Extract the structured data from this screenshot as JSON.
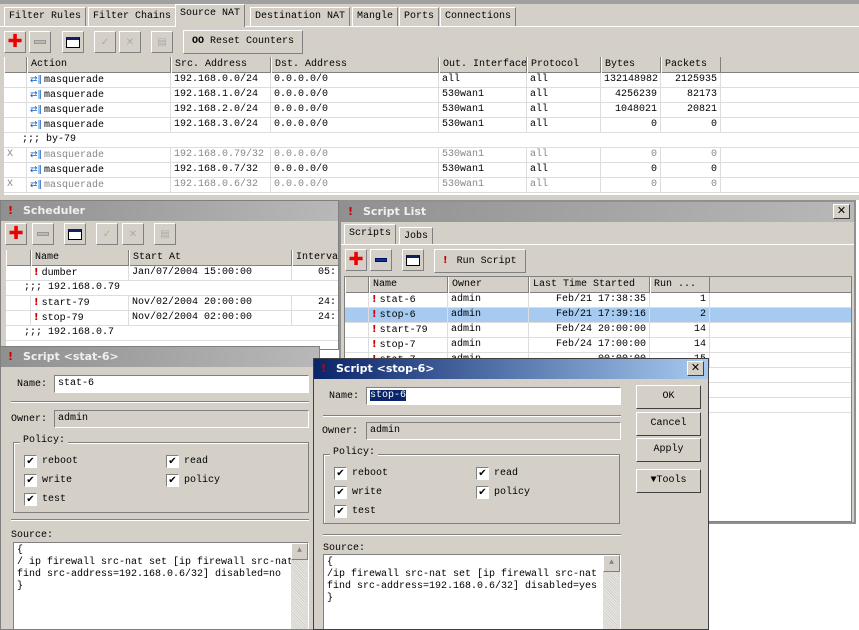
{
  "firewall": {
    "tabs": [
      "Filter Rules",
      "Filter Chains",
      "Source NAT",
      "Destination NAT",
      "Mangle",
      "Ports",
      "Connections"
    ],
    "selected_tab": "Source NAT",
    "reset_counters_label": "Reset Counters",
    "reset_counters_icon": "OO",
    "columns": [
      "",
      "Action",
      "Src. Address",
      "Dst. Address",
      "Out. Interface",
      "Protocol",
      "Bytes",
      "Packets"
    ],
    "rows": [
      {
        "flag": "",
        "action": "masquerade",
        "src": "192.168.0.0/24",
        "dst": "0.0.0.0/0",
        "out": "all",
        "proto": "all",
        "bytes": "132148982",
        "packets": "2125935"
      },
      {
        "flag": "",
        "action": "masquerade",
        "src": "192.168.1.0/24",
        "dst": "0.0.0.0/0",
        "out": "530wan1",
        "proto": "all",
        "bytes": "4256239",
        "packets": "82173"
      },
      {
        "flag": "",
        "action": "masquerade",
        "src": "192.168.2.0/24",
        "dst": "0.0.0.0/0",
        "out": "530wan1",
        "proto": "all",
        "bytes": "1048021",
        "packets": "20821"
      },
      {
        "flag": "",
        "action": "masquerade",
        "src": "192.168.3.0/24",
        "dst": "0.0.0.0/0",
        "out": "530wan1",
        "proto": "all",
        "bytes": "0",
        "packets": "0"
      },
      {
        "comment": ";;; by-79"
      },
      {
        "flag": "X",
        "disabled": true,
        "action": "masquerade",
        "src": "192.168.0.79/32",
        "dst": "0.0.0.0/0",
        "out": "530wan1",
        "proto": "all",
        "bytes": "0",
        "packets": "0"
      },
      {
        "flag": "",
        "action": "masquerade",
        "src": "192.168.0.7/32",
        "dst": "0.0.0.0/0",
        "out": "530wan1",
        "proto": "all",
        "bytes": "0",
        "packets": "0"
      },
      {
        "flag": "X",
        "disabled": true,
        "action": "masquerade",
        "src": "192.168.0.6/32",
        "dst": "0.0.0.0/0",
        "out": "530wan1",
        "proto": "all",
        "bytes": "0",
        "packets": "0"
      }
    ]
  },
  "scheduler": {
    "title": "Scheduler",
    "columns": [
      "",
      "Name",
      "Start At",
      "Interval"
    ],
    "rows": [
      {
        "name": "dumber",
        "start": "Jan/07/2004 15:00:00",
        "interval": "05:"
      },
      {
        "comment": ";;; 192.168.0.79"
      },
      {
        "name": "start-79",
        "start": "Nov/02/2004 20:00:00",
        "interval": "24:"
      },
      {
        "name": "stop-79",
        "start": "Nov/02/2004 02:00:00",
        "interval": "24:"
      },
      {
        "comment": ";;; 192.168.0.7"
      }
    ]
  },
  "script_list": {
    "title": "Script List",
    "tabs": [
      "Scripts",
      "Jobs"
    ],
    "selected_tab": "Scripts",
    "run_script_label": "Run Script",
    "columns": [
      "",
      "Name",
      "Owner",
      "Last Time Started",
      "Run ..."
    ],
    "rows": [
      {
        "name": "stat-6",
        "owner": "admin",
        "last": "Feb/21 17:38:35",
        "run": "1"
      },
      {
        "name": "stop-6",
        "owner": "admin",
        "last": "Feb/21 17:39:16",
        "run": "2",
        "selected": true
      },
      {
        "name": "start-79",
        "owner": "admin",
        "last": "Feb/24 20:00:00",
        "run": "14"
      },
      {
        "name": "stop-7",
        "owner": "admin",
        "last": "Feb/24 17:00:00",
        "run": "14"
      },
      {
        "name": "stat-7",
        "owner": "admin",
        "last": "00:00:00",
        "run": "15"
      }
    ]
  },
  "script_stat6": {
    "title": "Script <stat-6>",
    "name_label": "Name:",
    "name_value": "stat-6",
    "owner_label": "Owner:",
    "owner_value": "admin",
    "policy_label": "Policy:",
    "policies": [
      {
        "label": "reboot",
        "checked": true
      },
      {
        "label": "read",
        "checked": true
      },
      {
        "label": "write",
        "checked": true
      },
      {
        "label": "policy",
        "checked": true
      },
      {
        "label": "test",
        "checked": true
      }
    ],
    "source_label": "Source:",
    "source": "{\n/ ip firewall src-nat set [ip firewall src-nat\nfind src-address=192.168.0.6/32] disabled=no\n}"
  },
  "script_stop6": {
    "title": "Script <stop-6>",
    "name_label": "Name:",
    "name_value": "stop-6",
    "owner_label": "Owner:",
    "owner_value": "admin",
    "policy_label": "Policy:",
    "policies": [
      {
        "label": "reboot",
        "checked": true
      },
      {
        "label": "read",
        "checked": true
      },
      {
        "label": "write",
        "checked": true
      },
      {
        "label": "policy",
        "checked": true
      },
      {
        "label": "test",
        "checked": true
      }
    ],
    "source_label": "Source:",
    "source": "{\n/ip firewall src-nat set [ip firewall src-nat\nfind src-address=192.168.0.6/32] disabled=yes\n}",
    "buttons": {
      "ok": "OK",
      "cancel": "Cancel",
      "apply": "Apply",
      "tools": "▼Tools"
    }
  },
  "colors": {
    "selection": "#a6caf0",
    "active_title": "#0a246a",
    "accent_red": "#cc0000"
  }
}
